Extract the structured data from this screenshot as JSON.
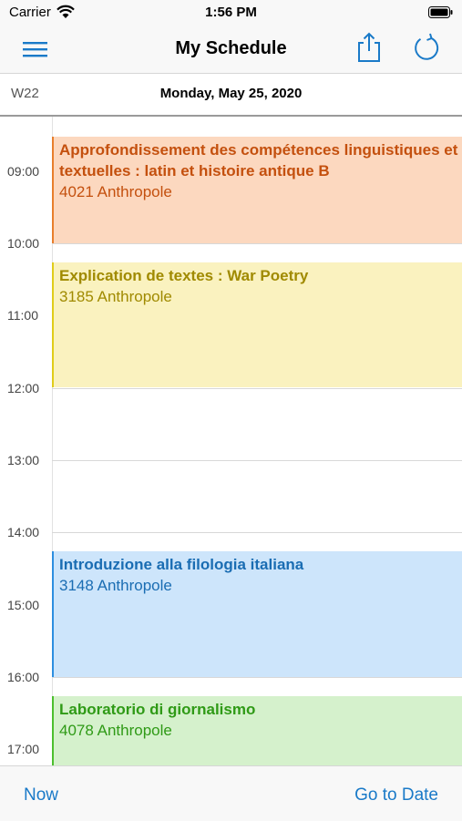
{
  "status_bar": {
    "carrier": "Carrier",
    "time": "1:56 PM",
    "wifi_icon": "wifi-icon",
    "battery_icon": "battery-icon"
  },
  "nav_bar": {
    "title": "My Schedule",
    "menu_icon": "hamburger-menu-icon",
    "share_icon": "share-icon",
    "refresh_icon": "refresh-icon",
    "accent": "#1a7ac8"
  },
  "date_header": {
    "week": "W22",
    "date": "Monday, May 25, 2020"
  },
  "timeline": {
    "hours": [
      "09:00",
      "10:00",
      "11:00",
      "12:00",
      "13:00",
      "14:00",
      "15:00",
      "16:00",
      "17:00"
    ],
    "events": [
      {
        "title": "Approfondissement des compétences linguistiques et textuelles : latin et histoire antique B",
        "room": "4021 Anthropole",
        "bg": "#fcd8bf",
        "border": "#e87e2c",
        "text": "#c4500e"
      },
      {
        "title": "Explication de textes : War Poetry",
        "room": "3185 Anthropole",
        "bg": "#faf2bf",
        "border": "#e0cc1a",
        "text": "#a08a00"
      },
      {
        "title": "Introduzione alla filologia italiana",
        "room": "3148 Anthropole",
        "bg": "#cde5fb",
        "border": "#2d8ee0",
        "text": "#1a6db3"
      },
      {
        "title": "Laboratorio di giornalismo",
        "room": "4078 Anthropole",
        "bg": "#d5f1cc",
        "border": "#4cbf2e",
        "text": "#2f9a16"
      }
    ]
  },
  "tab_bar": {
    "now": "Now",
    "go_to_date": "Go to Date"
  }
}
